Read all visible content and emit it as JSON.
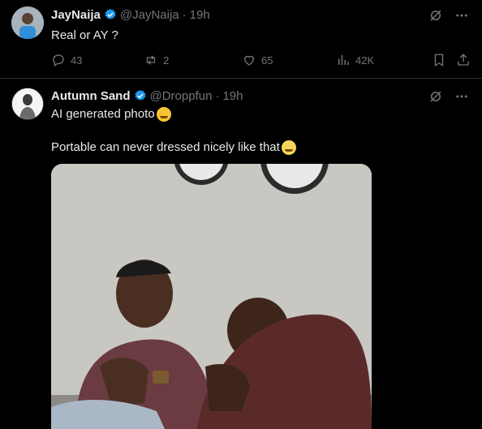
{
  "tweet1": {
    "name": "JayNaija",
    "handle": "@JayNaija",
    "dot": "·",
    "time": "19h",
    "text": "Real or AY ?",
    "actions": {
      "replies": "43",
      "retweets": "2",
      "likes": "65",
      "views": "42K"
    }
  },
  "tweet2": {
    "name": "Autumn Sand",
    "handle": "@Droppfun",
    "dot": "·",
    "time": "19h",
    "line1": "AI generated photo",
    "line2": "Portable can never dressed nicely like that"
  },
  "colors": {
    "background": "#000000",
    "text": "#e7e9ea",
    "muted": "#71767b",
    "verified": "#1d9bf0"
  }
}
